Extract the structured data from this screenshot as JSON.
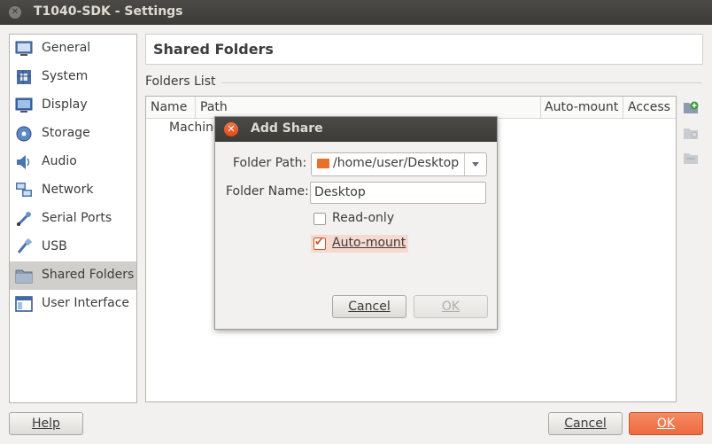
{
  "window": {
    "title": "T1040-SDK - Settings"
  },
  "sidebar": {
    "items": [
      {
        "label": "General",
        "icon": "general-monitor-icon"
      },
      {
        "label": "System",
        "icon": "system-chip-icon"
      },
      {
        "label": "Display",
        "icon": "display-monitor-icon"
      },
      {
        "label": "Storage",
        "icon": "storage-disk-icon"
      },
      {
        "label": "Audio",
        "icon": "audio-speaker-icon"
      },
      {
        "label": "Network",
        "icon": "network-icon"
      },
      {
        "label": "Serial Ports",
        "icon": "serial-port-icon"
      },
      {
        "label": "USB",
        "icon": "usb-icon"
      },
      {
        "label": "Shared Folders",
        "icon": "shared-folder-icon",
        "selected": true
      },
      {
        "label": "User Interface",
        "icon": "user-interface-icon"
      }
    ]
  },
  "page": {
    "title": "Shared Folders",
    "section_label": "Folders List"
  },
  "table": {
    "columns": [
      "Name",
      "Path",
      "Auto-mount",
      "Access"
    ],
    "rows": [
      {
        "name": "Machine Folders"
      }
    ],
    "row_visible_text": "Machine"
  },
  "dialog": {
    "title": "Add Share",
    "folder_path_label": "Folder Path:",
    "folder_path_value": "/home/user/Desktop",
    "folder_name_label": "Folder Name:",
    "folder_name_value": "Desktop",
    "readonly_label": "Read-only",
    "readonly_checked": false,
    "automount_label": "Auto-mount",
    "automount_checked": true,
    "cancel_label": "Cancel",
    "ok_label": "OK"
  },
  "footer": {
    "help_label": "Help",
    "cancel_label": "Cancel",
    "ok_label": "OK"
  },
  "colors": {
    "accent": "#ef6a3e",
    "titlebar": "#3c3b37",
    "selected": "#d0cfcc"
  }
}
